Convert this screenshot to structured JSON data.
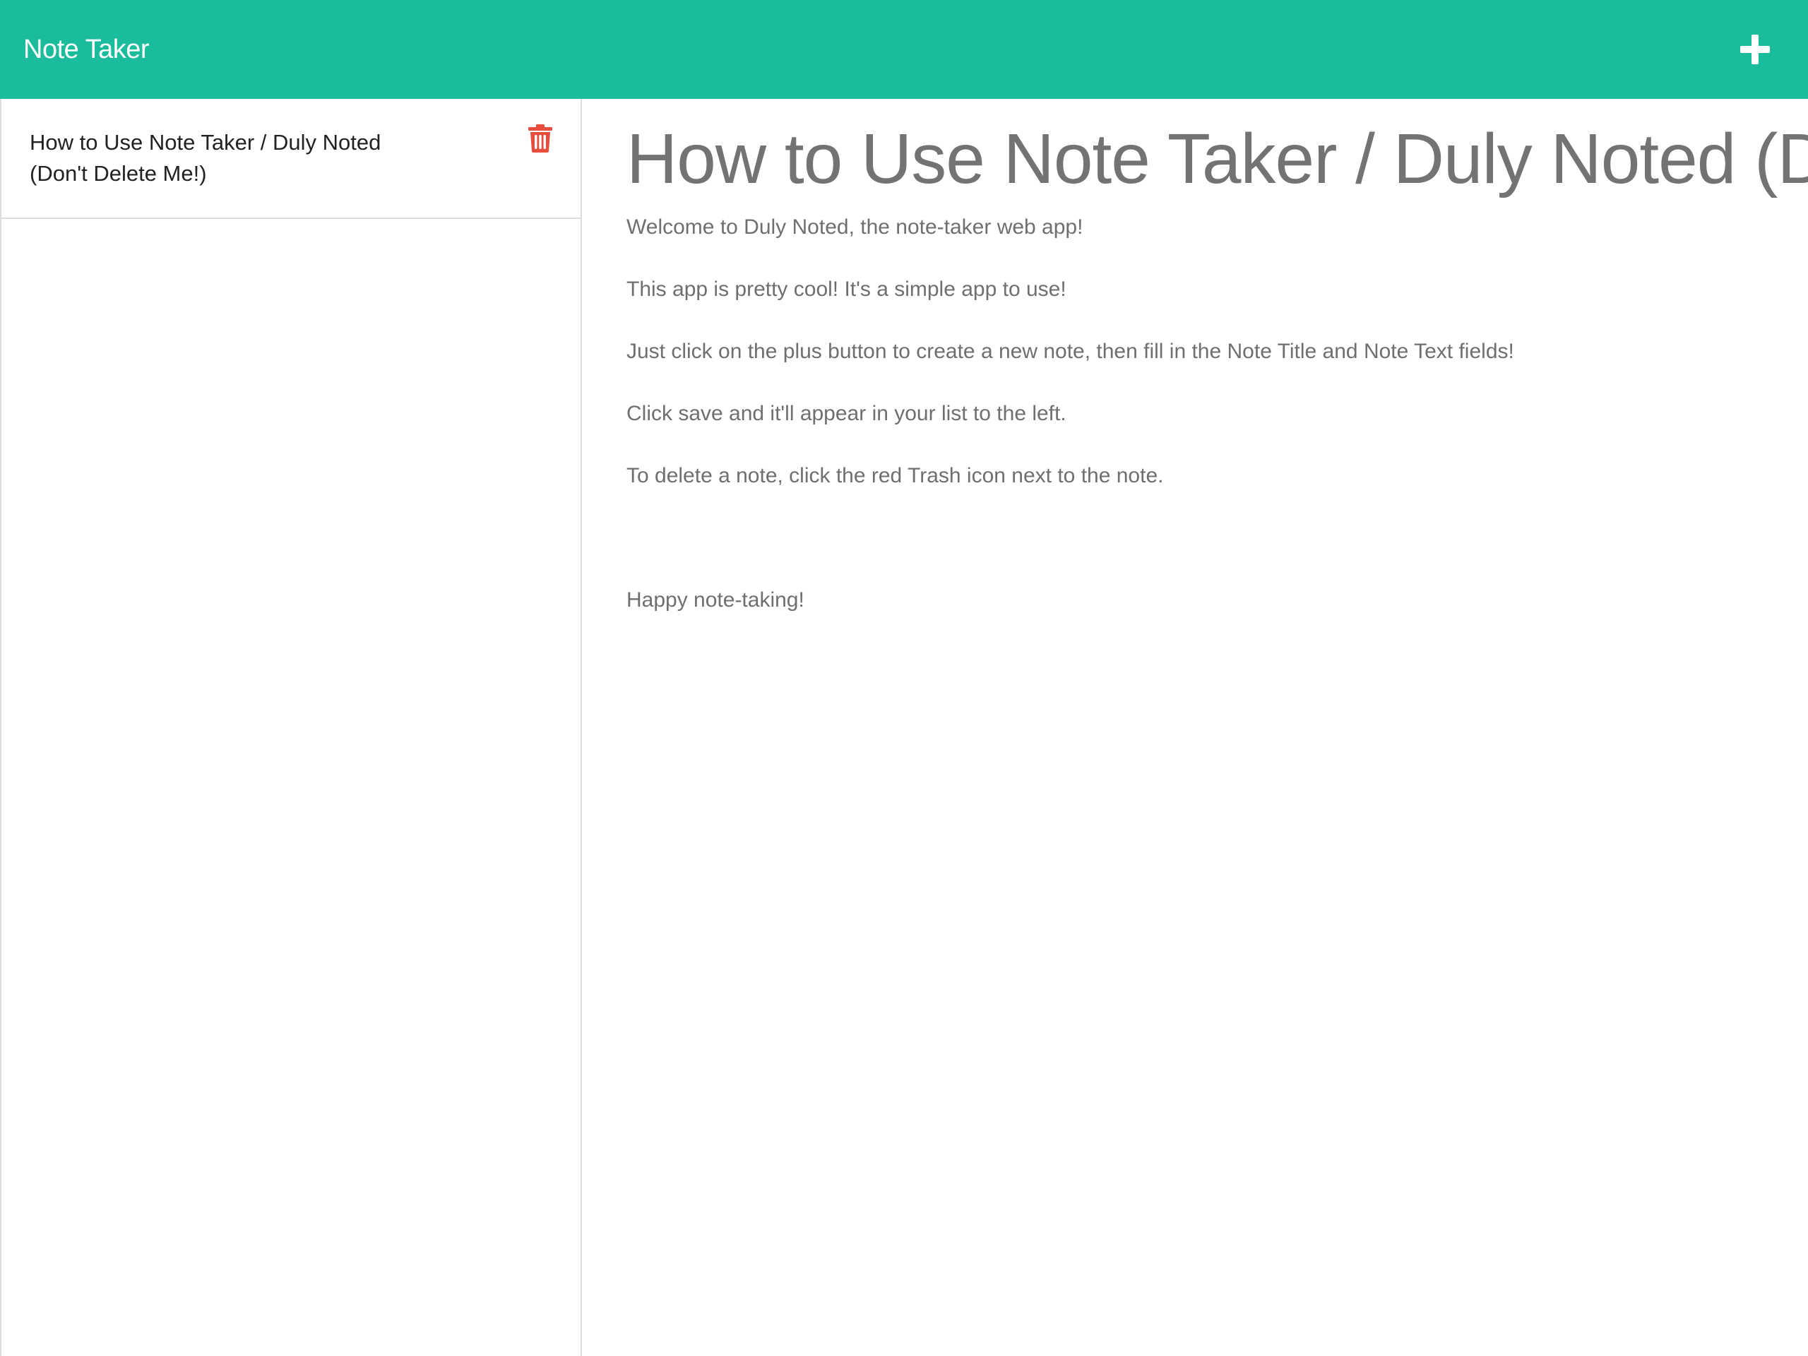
{
  "app": {
    "title": "Note Taker"
  },
  "header": {
    "new_note_icon": "plus-icon",
    "color": "#1abc9c"
  },
  "sidebar": {
    "notes": [
      {
        "title_line1": "How to Use Note Taker / Duly Noted",
        "title_line2": "(Don't Delete Me!)",
        "delete_icon": "trash-icon",
        "delete_color": "#e74c3c"
      }
    ]
  },
  "main": {
    "title": "How to Use Note Taker / Duly Noted (D",
    "paragraphs": [
      "Welcome to Duly Noted, the note-taker web app!",
      "This app is pretty cool! It's a simple app to use!",
      "Just click on the plus button to create a new note, then fill in the Note Title and Note Text fields!",
      "Click save and it'll appear in your list to the left.",
      "To delete a note, click the red Trash icon next to the note.",
      "",
      "Happy note-taking!"
    ]
  }
}
